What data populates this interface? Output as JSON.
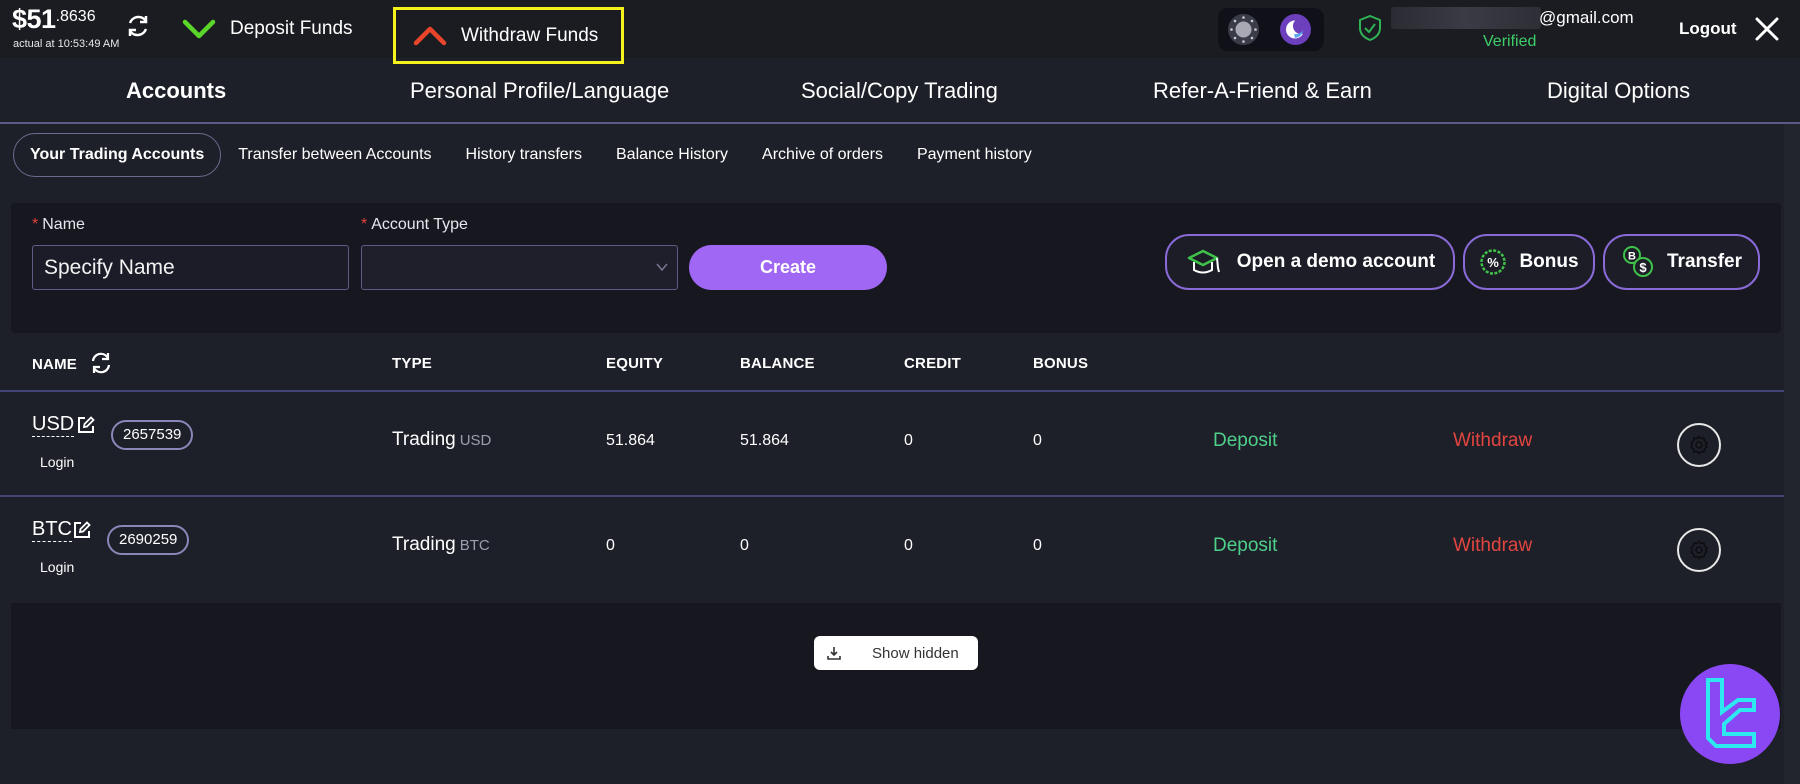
{
  "topbar": {
    "balance_main": "$51",
    "balance_decimal": ".8636",
    "balance_actual": "actual at 10:53:49 AM",
    "deposit_funds": "Deposit Funds",
    "withdraw_funds": "Withdraw Funds",
    "email_suffix": "@gmail.com",
    "verified": "Verified",
    "logout": "Logout"
  },
  "main_nav": [
    {
      "label": "Accounts",
      "active": true
    },
    {
      "label": "Personal Profile/Language"
    },
    {
      "label": "Social/Copy Trading"
    },
    {
      "label": "Refer-A-Friend & Earn"
    },
    {
      "label": "Digital Options"
    }
  ],
  "sub_nav": [
    {
      "label": "Your Trading Accounts",
      "active": true
    },
    {
      "label": "Transfer between Accounts"
    },
    {
      "label": "History transfers"
    },
    {
      "label": "Balance History"
    },
    {
      "label": "Archive of orders"
    },
    {
      "label": "Payment history"
    }
  ],
  "create_form": {
    "required_mark": "*",
    "name_label": "Name",
    "name_placeholder": "Specify Name",
    "type_label": "Account Type",
    "type_value": "",
    "create": "Create",
    "open_demo": "Open a demo account",
    "bonus": "Bonus",
    "transfer": "Transfer"
  },
  "table": {
    "headers": {
      "name": "NAME",
      "type": "TYPE",
      "equity": "EQUITY",
      "balance": "BALANCE",
      "credit": "CREDIT",
      "bonus": "BONUS"
    },
    "rows": [
      {
        "name": "USD",
        "number": "2657539",
        "login": "Login",
        "type": "Trading",
        "currency": "USD",
        "equity": "51.864",
        "balance": "51.864",
        "credit": "0",
        "bonus": "0",
        "deposit": "Deposit",
        "withdraw": "Withdraw"
      },
      {
        "name": "BTC",
        "number": "2690259",
        "login": "Login",
        "type": "Trading",
        "currency": "BTC",
        "equity": "0",
        "balance": "0",
        "credit": "0",
        "bonus": "0",
        "deposit": "Deposit",
        "withdraw": "Withdraw"
      }
    ]
  },
  "show_hidden": "Show hidden",
  "colors": {
    "accent_purple": "#a066f4",
    "deposit_green": "#4ecf8a",
    "withdraw_red": "#e2453f",
    "verified_green": "#3ecf6a",
    "highlight_yellow": "#f5f11a"
  }
}
